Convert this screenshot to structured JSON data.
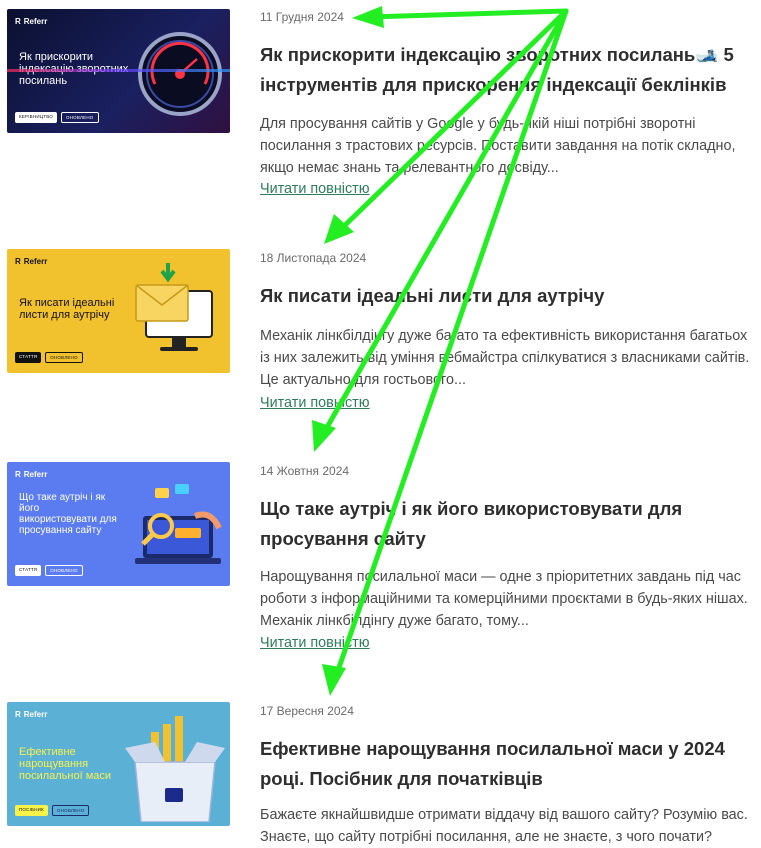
{
  "brand_name": "Referr",
  "read_more_label": "Читати повністю",
  "posts": [
    {
      "date": "11 Грудня 2024",
      "title": "Як прискорити індексацію зворотних посилань🎿 5 інструментів для прискорення індексації беклінків",
      "excerpt": "Для просування сайтів у Google у будь-якій ніші потрібні зворотні посилання з трастових ресурсів. Поставити завдання на потік складно, якщо немає знань та релевантного досвіду...",
      "thumb_title": "Як прискорити індексацію зворотних посилань",
      "thumb_tags": [
        "керівництво",
        "оновлено"
      ]
    },
    {
      "date": "18 Листопада 2024",
      "title": "Як писати ідеальні листи для аутрічу",
      "excerpt": "Механік лінкбілдінгу дуже багато та ефективність використання багатьох із них залежить від уміння вебмайстра спілкуватися з власниками сайтів. Це актуально для гостьового...",
      "thumb_title": "Як писати ідеальні листи для аутрічу",
      "thumb_tags": [
        "стаття",
        "оновлено"
      ]
    },
    {
      "date": "14 Жовтня 2024",
      "title": "Що таке аутріч і як його використовувати для просування сайту",
      "excerpt": "Нарощування посилальної маси — одне з пріоритетних завдань під час роботи з інформаційними та комерційними проєктами в будь-яких нішах. Механік лінкбілдінгу дуже багато, тому...",
      "thumb_title": "Що таке аутріч і як його використовувати для просування сайту",
      "thumb_tags": [
        "стаття",
        "оновлено"
      ]
    },
    {
      "date": "17 Вересня 2024",
      "title": "Ефективне нарощування посилальної маси у 2024 році. Посібник для початківців",
      "excerpt": "Бажаєте якнайшвидше отримати віддачу від вашого сайту? Розумію вас. Знаєте, що сайту потрібні посилання, але не знаєте, з чого почати?",
      "thumb_title": "Ефективне нарощування посилальної маси",
      "thumb_tags": [
        "посібник",
        "оновлено"
      ]
    }
  ],
  "colors": {
    "arrow": "#22ee22",
    "link": "#2e7d5b",
    "thumb1_bg": "#101634",
    "thumb2_bg": "#f2c12e",
    "thumb3_bg": "#5b7cf0",
    "thumb4_bg": "#5bb0d6"
  }
}
